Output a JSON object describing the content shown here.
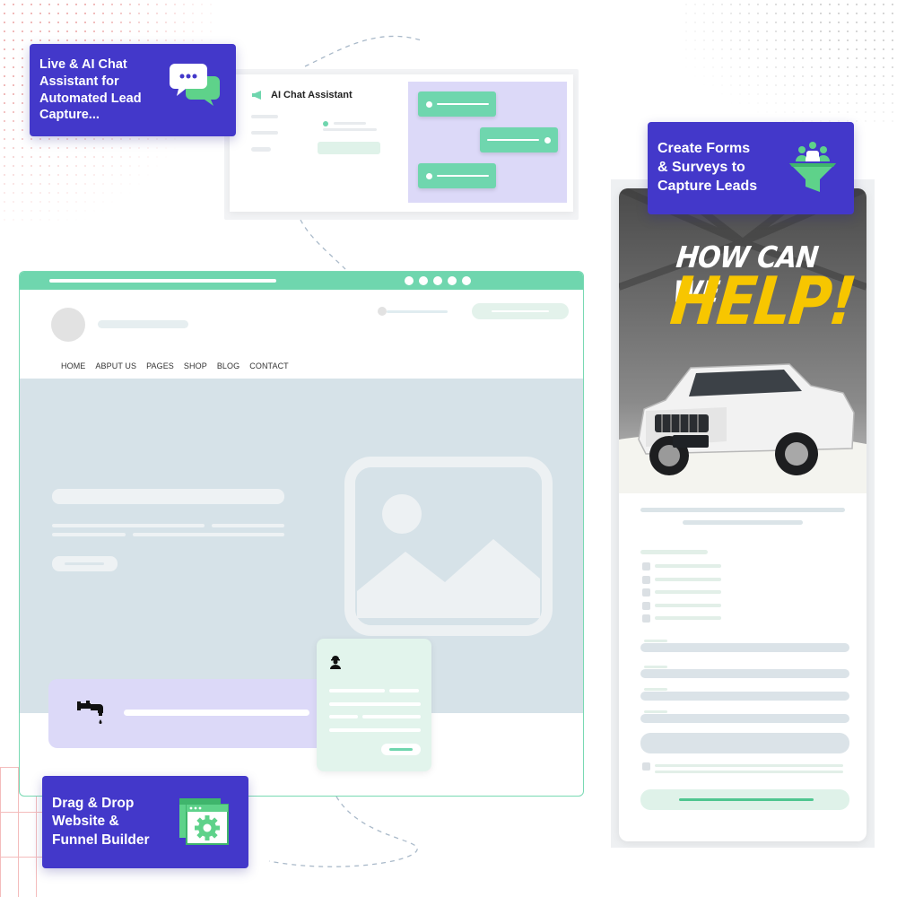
{
  "badges": {
    "chat": {
      "text": "Live & AI Chat Assistant for Automated Lead Capture...",
      "lines": [
        "Live & AI Chat",
        "Assistant for",
        "Automated Lead",
        "Capture..."
      ],
      "icon": "chat-bubbles-icon",
      "color": "#4338ca"
    },
    "forms": {
      "text": "Create Forms & Surveys to Capture Leads",
      "lines": [
        "Create Forms",
        "& Surveys to",
        "Capture Leads"
      ],
      "icon": "funnel-people-icon"
    },
    "builder": {
      "text": "Drag & Drop Website & Funnel Builder",
      "lines": [
        "Drag & Drop",
        "Website &",
        "Funnel Builder"
      ],
      "icon": "browser-gear-icon"
    }
  },
  "chat_card": {
    "title": "AI Chat Assistant",
    "icon": "megaphone-icon",
    "accent": "#6fd6ae",
    "panel_color": "#dcd9f8"
  },
  "website_builder": {
    "nav": [
      "HOME",
      "ABPUT US",
      "PAGES",
      "SHOP",
      "BLOG",
      "CONTACT"
    ],
    "hero_placeholder_icon": "image-placeholder-icon",
    "strip_icon": "faucet-icon",
    "contact_icon": "user-icon",
    "accent": "#6fd6ae"
  },
  "form_page": {
    "headline_1": "HOW CAN WE",
    "headline_2": "HELP!",
    "headline_color": "#f7c600",
    "image": "white-suv-image",
    "checkbox_count": 5,
    "input_count": 4
  }
}
